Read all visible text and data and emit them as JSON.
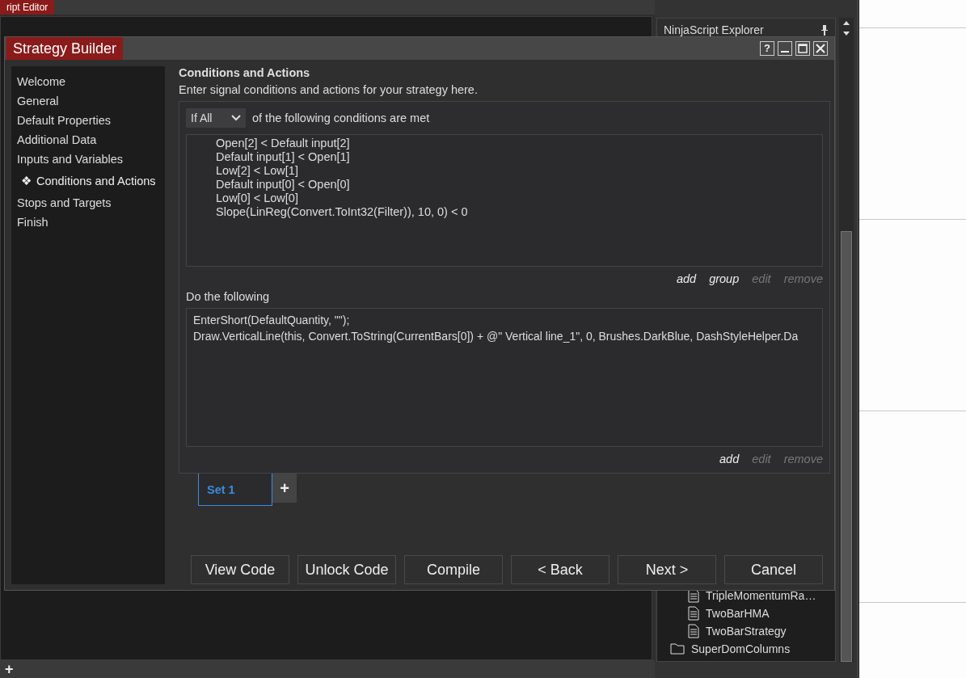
{
  "editor": {
    "tab": "ript Editor",
    "add_button": "+"
  },
  "explorer": {
    "title": "NinjaScript Explorer",
    "items": [
      {
        "kind": "file",
        "label": "TripleMomentumRa…"
      },
      {
        "kind": "file",
        "label": "TwoBarHMA"
      },
      {
        "kind": "file",
        "label": "TwoBarStrategy"
      },
      {
        "kind": "folder",
        "label": "SuperDomColumns"
      }
    ]
  },
  "dialog": {
    "title": "Strategy Builder",
    "help_button": "?"
  },
  "nav": {
    "marker": "❖",
    "items": [
      {
        "label": "Welcome",
        "selected": false
      },
      {
        "label": "General",
        "selected": false
      },
      {
        "label": "Default Properties",
        "selected": false
      },
      {
        "label": "Additional Data",
        "selected": false
      },
      {
        "label": "Inputs and Variables",
        "selected": false
      },
      {
        "label": "Conditions and Actions",
        "selected": true
      },
      {
        "label": "Stops and Targets",
        "selected": false
      },
      {
        "label": "Finish",
        "selected": false
      }
    ]
  },
  "heading": "Conditions and Actions",
  "description": "Enter signal conditions and actions for your strategy here.",
  "conditions": {
    "mode": "If All",
    "suffix": "of the following conditions are met",
    "lines": [
      "Open[2] < Default input[2]",
      "Default input[1] < Open[1]",
      "Low[2] < Low[1]",
      "Default input[0] < Open[0]",
      "Low[0] < Low[0]",
      "Slope(LinReg(Convert.ToInt32(Filter)), 10, 0) < 0"
    ],
    "links": [
      {
        "label": "add",
        "disabled": false
      },
      {
        "label": "group",
        "disabled": false
      },
      {
        "label": "edit",
        "disabled": true
      },
      {
        "label": "remove",
        "disabled": true
      }
    ]
  },
  "actions": {
    "label": "Do the following",
    "lines": [
      "EnterShort(DefaultQuantity, \"\");",
      "Draw.VerticalLine(this, Convert.ToString(CurrentBars[0]) + @\" Vertical line_1\", 0, Brushes.DarkBlue, DashStyleHelper.Da"
    ],
    "links": [
      {
        "label": "add",
        "disabled": false
      },
      {
        "label": "edit",
        "disabled": true
      },
      {
        "label": "remove",
        "disabled": true
      }
    ]
  },
  "sets": {
    "tabs": [
      {
        "label": "Set 1",
        "selected": true
      }
    ],
    "add_button": "+"
  },
  "buttons": [
    "View Code",
    "Unlock Code",
    "Compile",
    "< Back",
    "Next >",
    "Cancel"
  ]
}
